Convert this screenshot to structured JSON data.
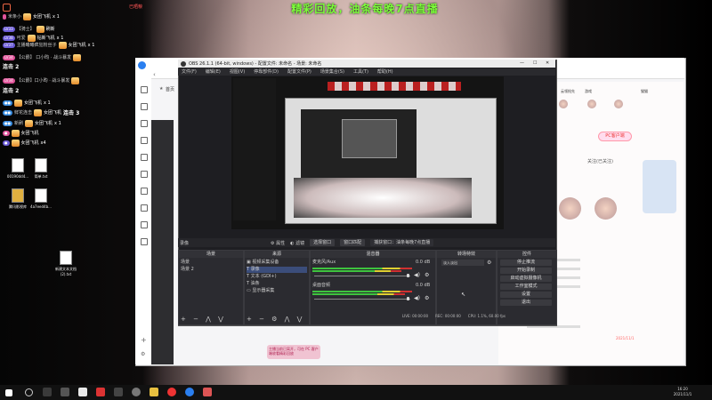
{
  "stream": {
    "banner": "精彩回放，油条每晚7点直播",
    "corner_link": "已晒粮",
    "chat": [
      {
        "level": "",
        "user": "米条小",
        "gift": "女团飞机",
        "count": "x 1"
      },
      {
        "level": "LV33",
        "user": "【骑士】",
        "gift": "刷新",
        "count": ""
      },
      {
        "level": "LV38",
        "user": "可爱",
        "gift": "钻新飞机",
        "count": "x 1"
      },
      {
        "level": "LV37",
        "user": "主播曦曦疯狂粉丝子",
        "gift": "女团飞机",
        "count": "x 1"
      },
      {
        "level": "LV34",
        "user": "【公爵】 口小昀 · 战斗暴发",
        "gift": "暴发",
        "count": ""
      },
      {
        "level": "",
        "user": "连击 2",
        "gift": "",
        "count": ""
      },
      {
        "level": "LV34",
        "user": "【公爵】口小昀 · 战斗暴发",
        "gift": "暴发",
        "count": ""
      },
      {
        "level": "",
        "user": "连击 2",
        "gift": "",
        "count": ""
      },
      {
        "level": "",
        "user": "",
        "gift": "女团飞机",
        "count": "x 1"
      },
      {
        "level": "",
        "user": "鲜花连击",
        "gift": "女团飞机",
        "count": "连击 3"
      },
      {
        "level": "",
        "user": "新刷",
        "gift": "女团飞机",
        "count": "x 1"
      },
      {
        "level": "",
        "user": "",
        "gift": "女团飞机",
        "count": ""
      },
      {
        "level": "",
        "user": "",
        "gift": "女团飞机",
        "count": "x4"
      }
    ],
    "desktop_icons": [
      "00190dd4...",
      "简单.txt",
      "腾讯影视库",
      "4a7eed4b...",
      "新建文本文档\n(2).txt"
    ]
  },
  "browser": {
    "home_label": "首页",
    "chips": [
      "云领抢先",
      "游戏",
      "猫猫"
    ],
    "pc_chip": "PC客户端",
    "follow_label": "关注(已关注)",
    "date": "2021/11/1"
  },
  "obs": {
    "title": "OBS 26.1.1 (64-bit, windows) - 配置文件: 未命名 - 场景: 未命名",
    "window_controls": [
      "—",
      "☐",
      "✕"
    ],
    "menu": [
      "文件(F)",
      "编辑(E)",
      "视图(V)",
      "停靠部件(D)",
      "配置文件(P)",
      "场景集合(S)",
      "工具(T)",
      "帮助(H)"
    ],
    "source_toolbar": {
      "selected": "录像",
      "properties": "属性",
      "filters": "滤镜",
      "select_window": "选择窗口",
      "window_match": "窗口匹配",
      "capture_hint": "捕获窗口：油条每晚7点直播"
    },
    "docks": {
      "scenes": {
        "title": "场景",
        "items": [
          "场景",
          "场景 2"
        ]
      },
      "sources": {
        "title": "来源",
        "items": [
          "视频采集设备",
          "录像",
          "文本 (GDI+)",
          "油条",
          "显示器采集"
        ]
      },
      "mixer": {
        "title": "混音器",
        "channels": [
          {
            "name": "麦克风/Aux",
            "db": "0.0 dB"
          },
          {
            "name": "桌面音频",
            "db": "0.0 dB"
          }
        ]
      },
      "transitions": {
        "title": "转场特效",
        "value": "淡入淡出",
        "duration_label": ""
      },
      "controls": {
        "title": "控件",
        "buttons": [
          "停止推流",
          "开始录制",
          "启动虚拟摄像机",
          "工作室模式",
          "设置",
          "退出"
        ]
      }
    },
    "status": {
      "live": "LIVE: 00:00:00",
      "rec": "REC: 00:00:00",
      "cpu": "CPU: 1.1%, 60.00 fps"
    }
  },
  "taskbar": {
    "time": "16:20",
    "date": "2021/11/1"
  },
  "toast": "主播当前已离开，可在 PC 客户端收看精彩回放"
}
